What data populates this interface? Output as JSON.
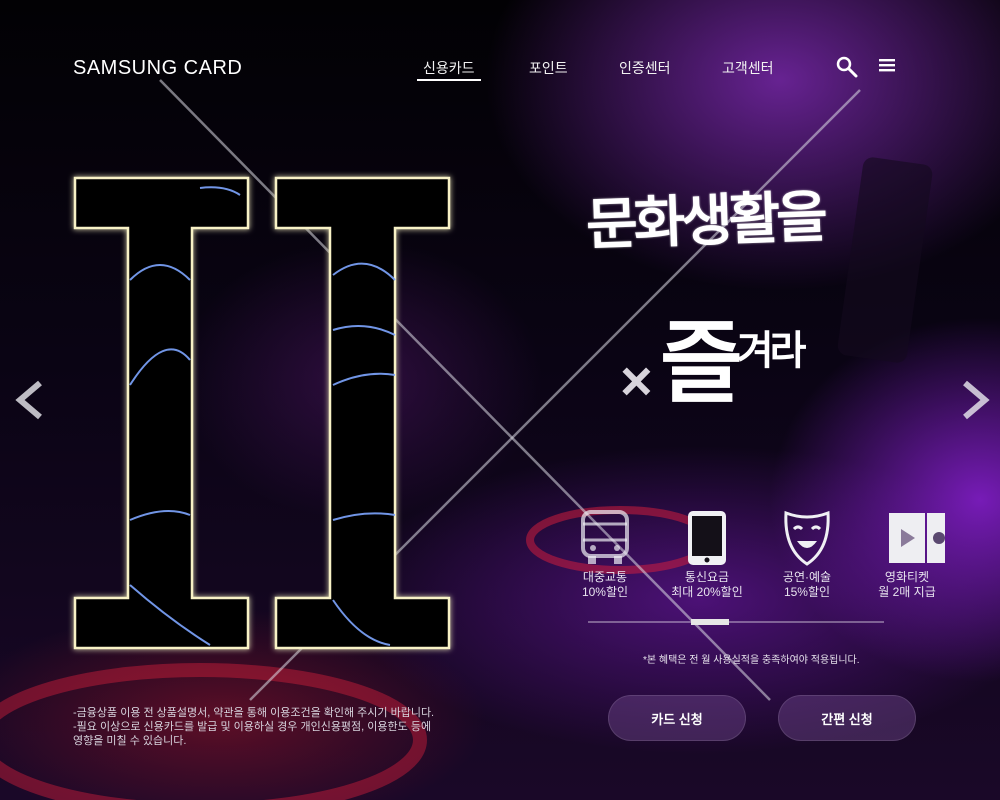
{
  "header": {
    "logo": "SAMSUNG CARD",
    "nav": [
      {
        "label": "신용카드",
        "active": true
      },
      {
        "label": "포인트",
        "active": false
      },
      {
        "label": "인증센터",
        "active": false
      },
      {
        "label": "고객센터",
        "active": false
      }
    ],
    "icons": [
      "search-icon",
      "menu-icon"
    ]
  },
  "hero": {
    "logo_mark": "II",
    "headline_line1": "문화생활을",
    "headline_x": "×",
    "headline_line2_big": "즐",
    "headline_line2_small": "겨라"
  },
  "benefits": [
    {
      "icon": "bus-icon",
      "line1": "대중교통",
      "line2": "10%할인"
    },
    {
      "icon": "tablet-icon",
      "line1": "통신요금",
      "line2": "최대 20%할인"
    },
    {
      "icon": "theater-mask-icon",
      "line1": "공연·예술",
      "line2": "15%할인"
    },
    {
      "icon": "film-ticket-icon",
      "line1": "영화티켓",
      "line2": "월 2매 지급"
    }
  ],
  "carousel": {
    "position": 0.4
  },
  "note": "*본 혜택은 전 월 사용실적을 충족하여야 적용됩니다.",
  "disclaimer": [
    "-금융상품 이용 전 상품설명서, 약관을 통해 이용조건을 확인해 주시기 바랍니다.",
    "-필요 이상으로 신용카드를 발급 및 이용하실 경우 개인신용평점, 이용한도 등에",
    "영향을 미칠 수 있습니다."
  ],
  "buttons": {
    "card_apply": "카드 신청",
    "easy_apply": "간편 신청"
  },
  "colors": {
    "accent_purple": "#7a2bc8",
    "neon_red": "#d4203a",
    "outline_glow": "#f6f0b0"
  }
}
